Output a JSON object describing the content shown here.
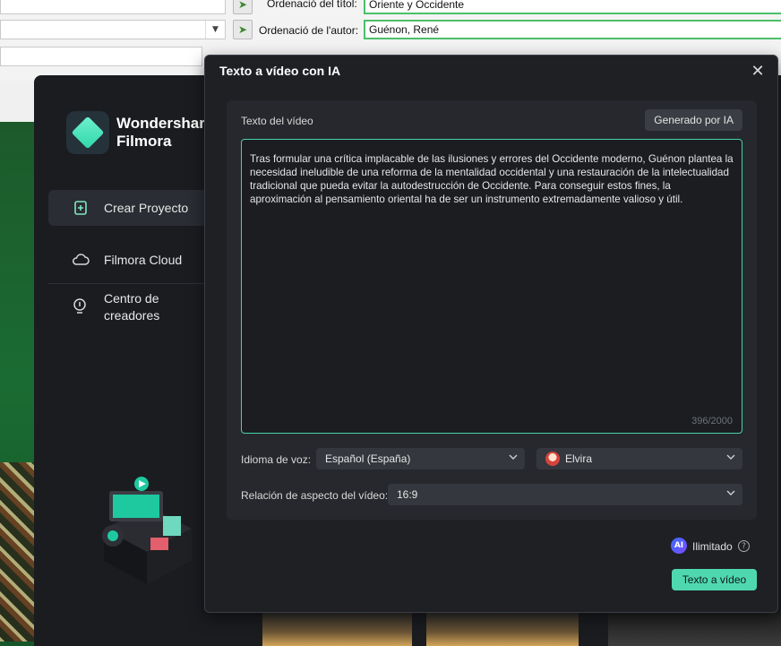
{
  "background_app": {
    "title_label": "Ordenació del títol:",
    "title_value": "Oriente y Occidente",
    "author_label": "Ordenació de l'autor:",
    "author_value": "Guénon, René"
  },
  "filmora": {
    "brand_line1": "Wondershar",
    "brand_line2": "Filmora",
    "nav": {
      "create": "Crear Proyecto",
      "cloud": "Filmora Cloud",
      "creators_line1": "Centro de",
      "creators_line2": "creadores"
    }
  },
  "modal": {
    "title": "Texto a vídeo con IA",
    "text_label": "Texto del vídeo",
    "generate_button": "Generado por IA",
    "text_value": "Tras formular una crítica implacable de las ilusiones y errores del Occidente moderno, Guénon plantea la necesidad ineludible de una reforma de la mentalidad occidental y una restauración de la intelectualidad tradicional que pueda evitar la autodestrucción de Occidente. Para conseguir estos fines, la aproximación al pensamiento oriental ha de ser un instrumento extremadamente valioso y útil.",
    "counter": "396/2000",
    "voice_language_label": "Idioma de voz:",
    "voice_language_value": "Español (España)",
    "voice_value": "Elvira",
    "aspect_label": "Relación de aspecto del vídeo:",
    "aspect_value": "16:9",
    "ai_badge": "AI",
    "unlimited": "Ilimitado",
    "submit_button": "Texto a vídeo"
  },
  "colors": {
    "accent": "#4fd8b0",
    "modal_bg": "#1e2024",
    "panel_bg": "#26282d",
    "input_border": "#47d3a8"
  }
}
